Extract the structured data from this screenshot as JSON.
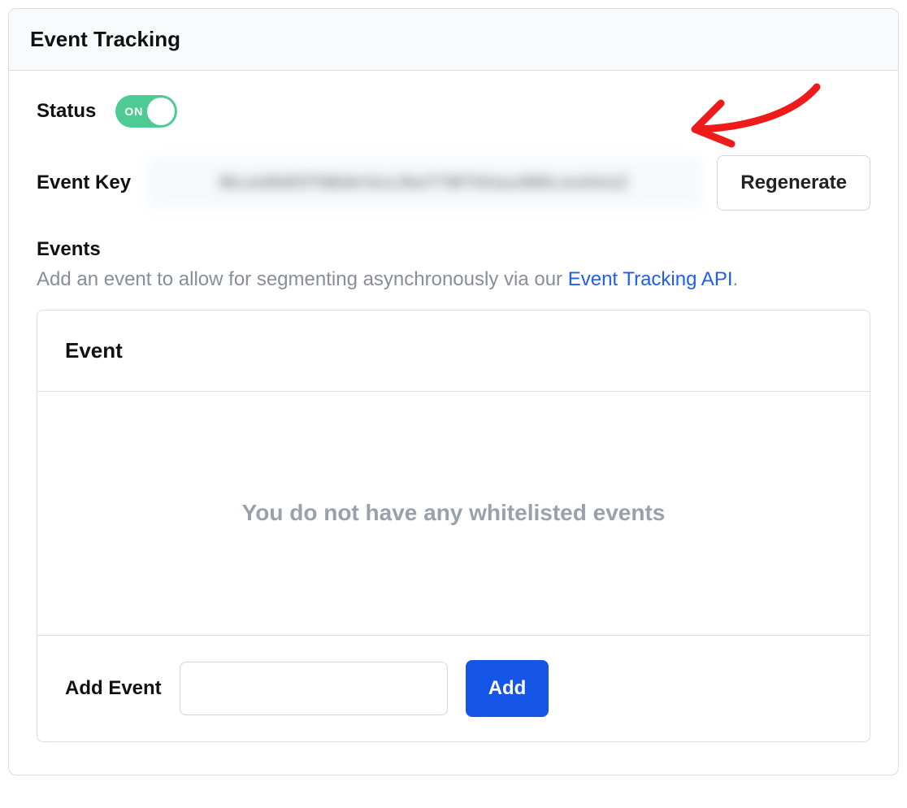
{
  "header": {
    "title": "Event Tracking"
  },
  "status": {
    "label": "Status",
    "toggle_text": "ON",
    "on": true
  },
  "event_key": {
    "label": "Event Key",
    "value_masked": "Wcstd9df3T6BdtrGcLRwT7WTGhavdWILmshUzZ",
    "regenerate_label": "Regenerate"
  },
  "events": {
    "heading": "Events",
    "description_prefix": "Add an event to allow for segmenting asynchronously via our ",
    "description_link": "Event Tracking API",
    "description_suffix": ".",
    "column_header": "Event",
    "empty_message": "You do not have any whitelisted events",
    "add_event_label": "Add Event",
    "add_event_value": "",
    "add_button_label": "Add"
  },
  "colors": {
    "accent_blue": "#1455e6",
    "toggle_green": "#4ecb94",
    "annotation_red": "#ef1a1a",
    "link_blue": "#1d5ef2"
  }
}
